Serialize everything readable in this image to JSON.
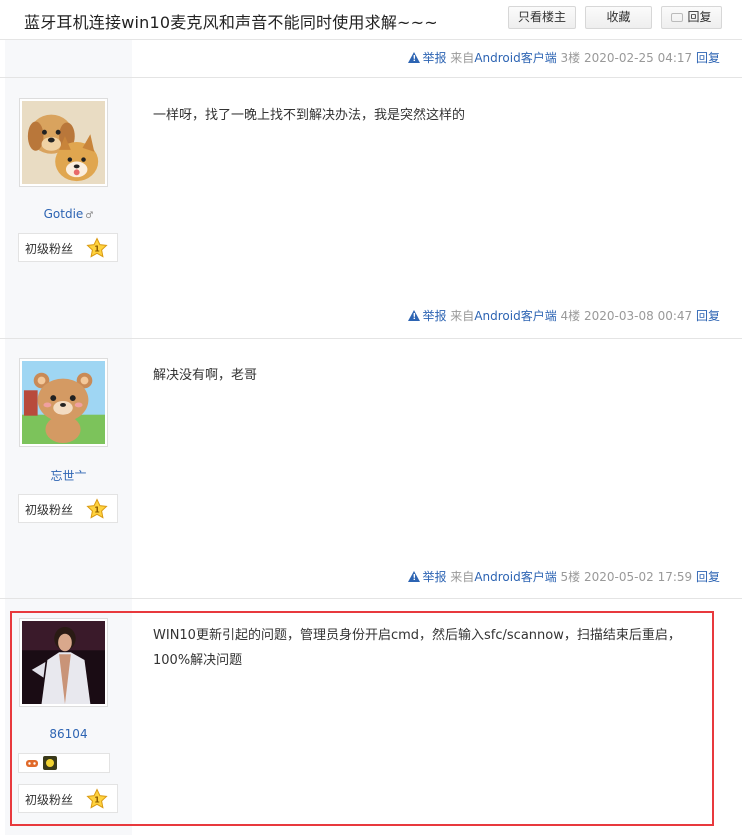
{
  "thread": {
    "title": "蓝牙耳机连接win10麦克风和声音不能同时使用求解~~~"
  },
  "toolbar": {
    "only_op_label": "只看楼主",
    "favorite_label": "收藏",
    "reply_label": "回复"
  },
  "posts": [
    {
      "report": "举报",
      "source_prefix": "来自",
      "source_name": "Android客户端",
      "floor": "3楼",
      "time": "2020-02-25 04:17",
      "reply": "回复"
    },
    {
      "username": "Gotdie",
      "gender": "♂",
      "level_label": "初级粉丝",
      "level_number": "1",
      "content": "一样呀，找了一晚上找不到解决办法，我是突然这样的",
      "report": "举报",
      "source_prefix": "来自",
      "source_name": "Android客户端",
      "floor": "4楼",
      "time": "2020-03-08 00:47",
      "reply": "回复"
    },
    {
      "username": "忘世亠",
      "level_label": "初级粉丝",
      "level_number": "1",
      "content": "解决没有啊，老哥",
      "report": "举报",
      "source_prefix": "来自",
      "source_name": "Android客户端",
      "floor": "5楼",
      "time": "2020-05-02 17:59",
      "reply": "回复"
    },
    {
      "username": "86104",
      "level_label": "初级粉丝",
      "level_number": "1",
      "content_line1": "WIN10更新引起的问题，管理员身份开启cmd，然后输入sfc/scannow，扫描结束后重启，",
      "content_line2": "100%解决问题"
    }
  ],
  "colors": {
    "link": "#2d64b3",
    "highlight": "#e8393d",
    "sidebar": "#f7f8fa"
  }
}
